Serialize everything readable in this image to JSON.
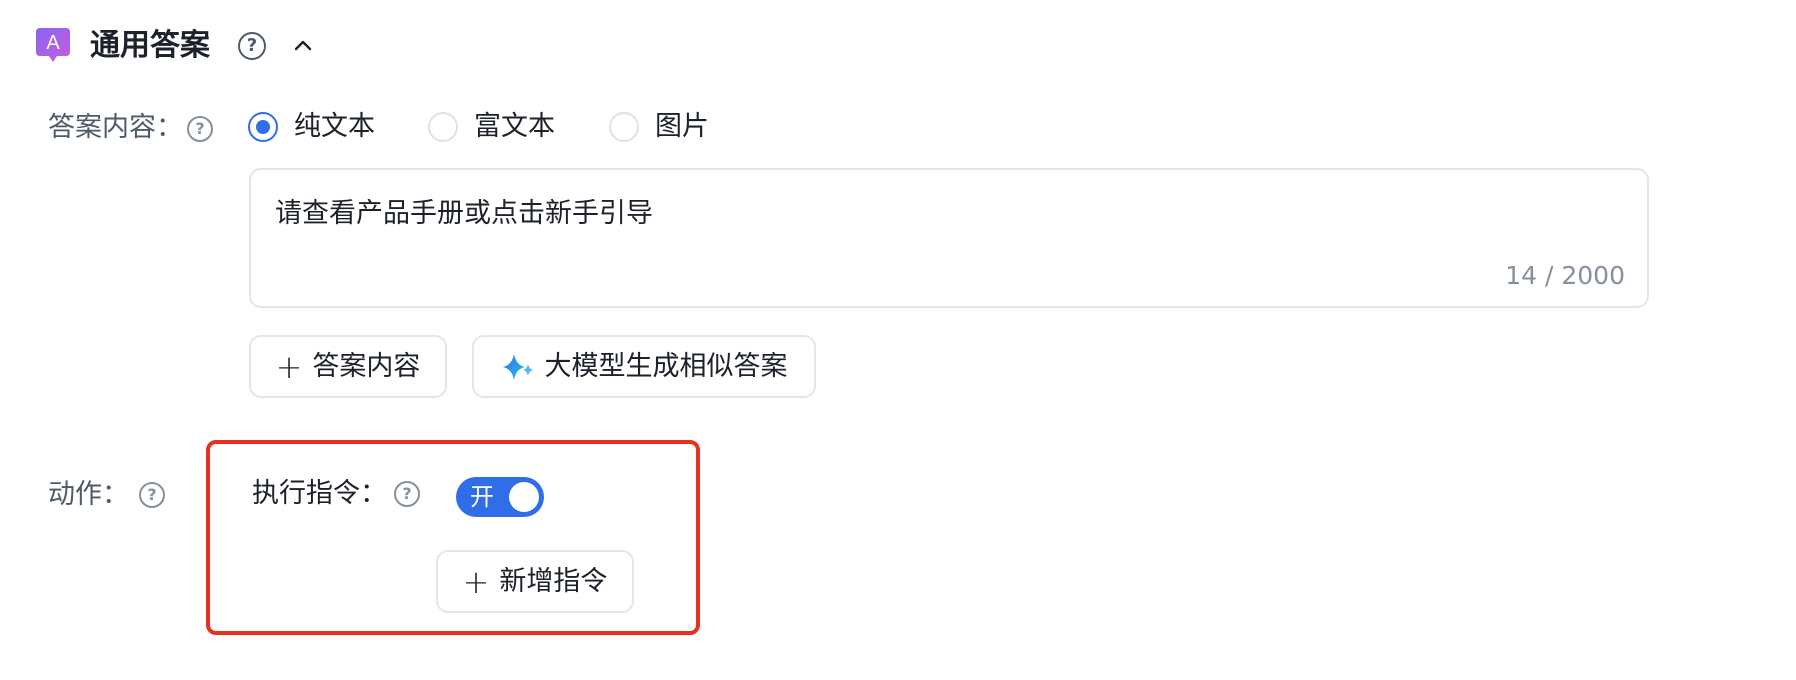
{
  "header": {
    "title": "通用答案",
    "help_icon": "question-circle-icon",
    "collapse_icon": "chevron-up-icon"
  },
  "answer_section": {
    "label": "答案内容：",
    "help_icon": "question-circle-icon",
    "type_options": [
      {
        "label": "纯文本",
        "checked": true
      },
      {
        "label": "富文本",
        "checked": false
      },
      {
        "label": "图片",
        "checked": false
      }
    ],
    "textarea": {
      "value": "请查看产品手册或点击新手引导",
      "count": "14 / 2000"
    },
    "buttons": {
      "add_answer": "答案内容",
      "ai_generate": "大模型生成相似答案"
    }
  },
  "action_section": {
    "label": "动作：",
    "help_icon": "question-circle-icon",
    "execute_label": "执行指令：",
    "switch_text": "开",
    "switch_on": true,
    "add_command": "新增指令"
  },
  "colors": {
    "accent": "#2f6ee8",
    "highlight_border": "#e8301f",
    "logo_gradient_start": "#8a63f2",
    "logo_gradient_end": "#c45ee0"
  }
}
